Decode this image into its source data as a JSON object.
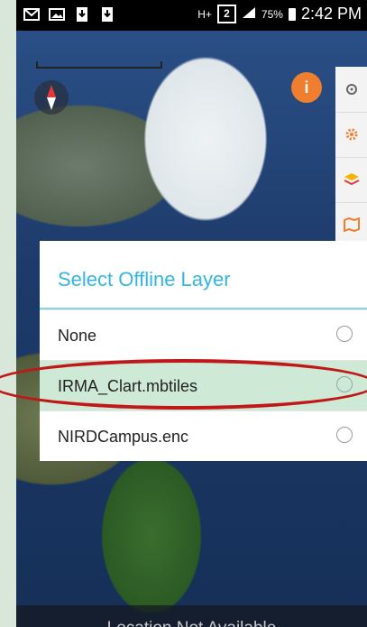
{
  "status_bar": {
    "signal_type": "H+",
    "sim_slot": "2",
    "battery_percent": "75%",
    "time": "2:42 PM",
    "icons_left": [
      "mail-icon",
      "image-icon",
      "download-icon",
      "download-icon"
    ]
  },
  "dialog": {
    "title": "Select Offline Layer",
    "options": [
      {
        "label": "None"
      },
      {
        "label": "IRMA_Clart.mbtiles"
      },
      {
        "label": "NIRDCampus.enc"
      }
    ]
  },
  "map": {
    "info_button_label": "i"
  },
  "bottom_bar": {
    "status": "Location Not Available"
  },
  "colors": {
    "accent": "#33b5e5",
    "highlight": "#cfe9d7",
    "annotation": "#c01818",
    "info_button": "#ef7e2f"
  }
}
